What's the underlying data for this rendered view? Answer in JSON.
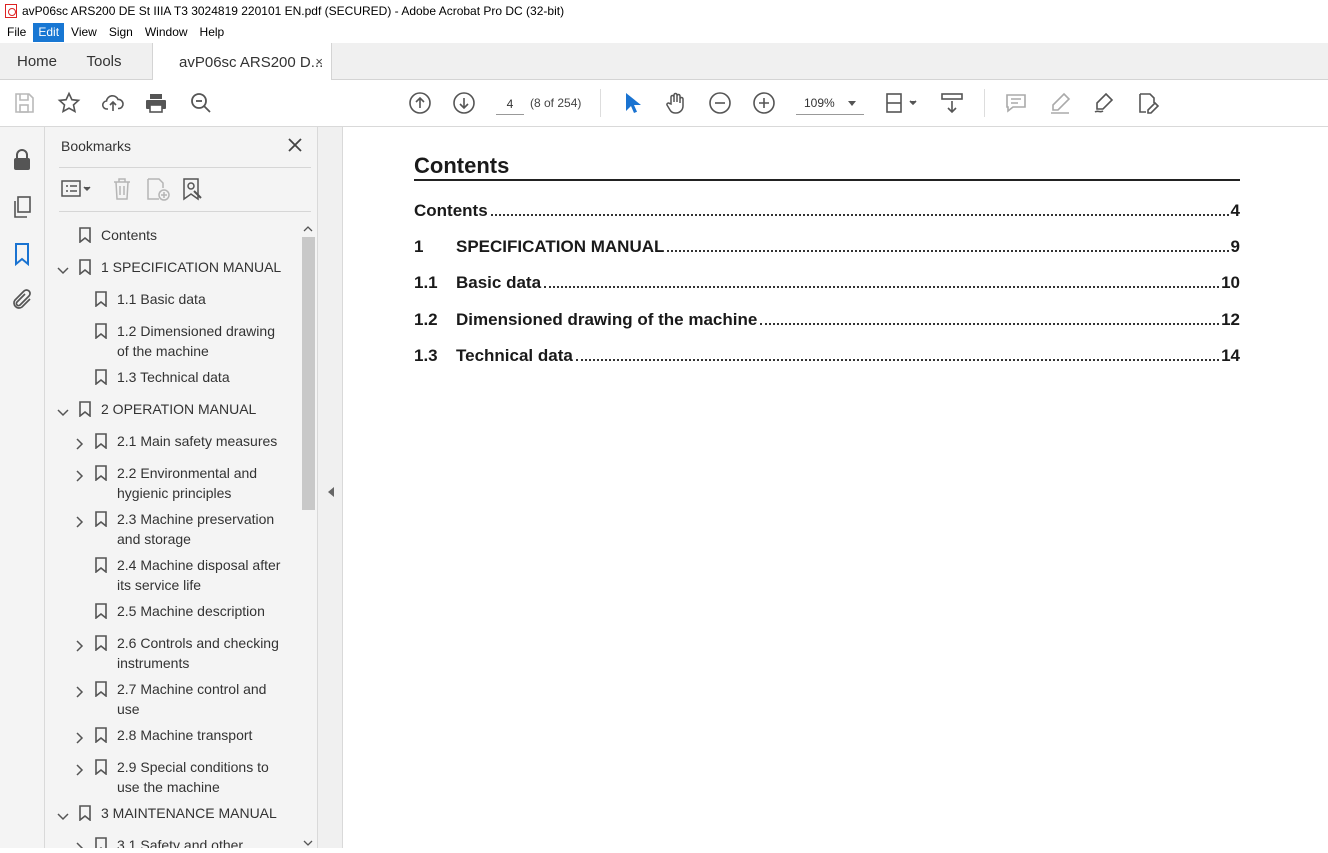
{
  "window": {
    "title": "avP06sc ARS200 DE St IIIA T3 3024819 220101 EN.pdf (SECURED) - Adobe Acrobat Pro DC (32-bit)"
  },
  "menu": [
    "File",
    "Edit",
    "View",
    "Sign",
    "Window",
    "Help"
  ],
  "menu_active": "Edit",
  "tabs": {
    "home": "Home",
    "tools": "Tools",
    "doc": "avP06sc ARS200 D...",
    "doc_close": "×"
  },
  "toolbar": {
    "page_value": "4",
    "page_count": "(8 of 254)",
    "zoom": "109%"
  },
  "rail_icons": [
    "lock-icon",
    "pages-icon",
    "bookmark-icon",
    "attachment-icon"
  ],
  "bookmarks": {
    "title": "Bookmarks",
    "items": [
      {
        "label": "Contents",
        "level": 0,
        "chevron": "none"
      },
      {
        "label": "1 SPECIFICATION MANUAL",
        "level": 0,
        "chevron": "down"
      },
      {
        "label": "1.1 Basic data",
        "level": 1,
        "chevron": "none"
      },
      {
        "label": "1.2 Dimensioned drawing",
        "label2": "of the machine",
        "level": 1,
        "chevron": "none"
      },
      {
        "label": "1.3 Technical data",
        "level": 1,
        "chevron": "none"
      },
      {
        "label": "2 OPERATION MANUAL",
        "level": 0,
        "chevron": "down"
      },
      {
        "label": "2.1 Main safety measures",
        "level": 1,
        "chevron": "right"
      },
      {
        "label": "2.2 Environmental and",
        "label2": "hygienic principles",
        "level": 1,
        "chevron": "right"
      },
      {
        "label": "2.3 Machine preservation",
        "label2": "and storage",
        "level": 1,
        "chevron": "right"
      },
      {
        "label": "2.4 Machine disposal after",
        "label2": "its service life",
        "level": 1,
        "chevron": "none"
      },
      {
        "label": "2.5 Machine description",
        "level": 1,
        "chevron": "none"
      },
      {
        "label": "2.6 Controls and checking",
        "label2": "instruments",
        "level": 1,
        "chevron": "right"
      },
      {
        "label": "2.7 Machine control and",
        "label2": "use",
        "level": 1,
        "chevron": "right"
      },
      {
        "label": "2.8 Machine transport",
        "level": 1,
        "chevron": "right"
      },
      {
        "label": "2.9 Special conditions to",
        "label2": "use the machine",
        "level": 1,
        "chevron": "right"
      },
      {
        "label": "3 MAINTENANCE MANUAL",
        "level": 0,
        "chevron": "down"
      },
      {
        "label": "3.1 Safety and other",
        "level": 1,
        "chevron": "right"
      }
    ]
  },
  "document": {
    "heading": "Contents",
    "toc": [
      {
        "num": "",
        "text": "Contents",
        "page": "4"
      },
      {
        "num": "1",
        "text": "SPECIFICATION MANUAL",
        "page": "9"
      },
      {
        "num": "1.1",
        "text": "Basic data",
        "page": "10"
      },
      {
        "num": "1.2",
        "text": "Dimensioned drawing of the machine",
        "page": "12"
      },
      {
        "num": "1.3",
        "text": "Technical data",
        "page": "14"
      }
    ]
  }
}
